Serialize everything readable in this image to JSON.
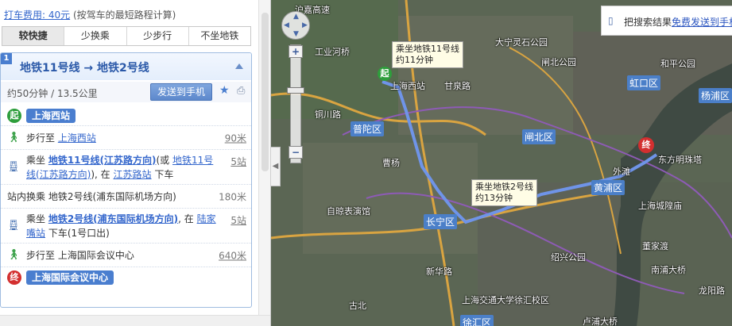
{
  "fare": {
    "label": "打车费用: 40元",
    "note": "(按驾车的最短路程计算)"
  },
  "tabs": [
    "较快捷",
    "少换乘",
    "少步行",
    "不坐地铁"
  ],
  "route": {
    "index": "1",
    "title": "地铁11号线 → 地铁2号线",
    "summary": "约50分钟 / 13.5公里",
    "send_label": "发送到手机",
    "start_badge": "起",
    "start_name": "上海西站",
    "end_badge": "终",
    "end_name": "上海国际会议中心",
    "steps": [
      {
        "pre": "步行至 ",
        "link": "上海西站",
        "dist": "90米"
      },
      {
        "pre": "乘坐 ",
        "line": "地铁11号线(江苏路方向)",
        "mid": "(或 ",
        "alt": "地铁11号线(江苏路方向)",
        "mid2": "), 在 ",
        "stop": "江苏路站",
        "post": " 下车",
        "dist": "5站"
      },
      {
        "text": "站内换乘 地铁2号线(浦东国际机场方向)",
        "dist": "180米"
      },
      {
        "pre": "乘坐 ",
        "line": "地铁2号线(浦东国际机场方向)",
        "mid": ", 在 ",
        "stop": "陆家嘴站",
        "post": " 下车(1号口出)",
        "dist": "5站"
      },
      {
        "text": "步行至 上海国际会议中心",
        "dist": "640米"
      }
    ]
  },
  "map": {
    "tip1": {
      "line1": "乘坐地铁11号线",
      "line2": "约11分钟"
    },
    "tip2": {
      "line1": "乘坐地铁2号线",
      "line2": "约13分钟"
    },
    "start_badge": "起",
    "end_badge": "终",
    "search_hint": "把搜索结果",
    "search_link": "免费发送到手机",
    "districts": [
      "普陀区",
      "闸北区",
      "虹口区",
      "杨浦区",
      "黄浦区",
      "长宁区",
      "徐汇区"
    ],
    "labels": [
      "沪嘉高速",
      "大宁灵石公园",
      "闸北公园",
      "和平公园",
      "工业河桥",
      "上海西站",
      "甘泉路",
      "铜川路",
      "曹杨",
      "外滩",
      "东方明珠塔",
      "上海城隍庙",
      "自晾表演馆",
      "董家渡",
      "南浦大桥",
      "新华路",
      "上海交通大学徐汇校区",
      "古北",
      "龙阳路",
      "绍兴公园",
      "卢浦大桥",
      "杨浦区"
    ]
  }
}
